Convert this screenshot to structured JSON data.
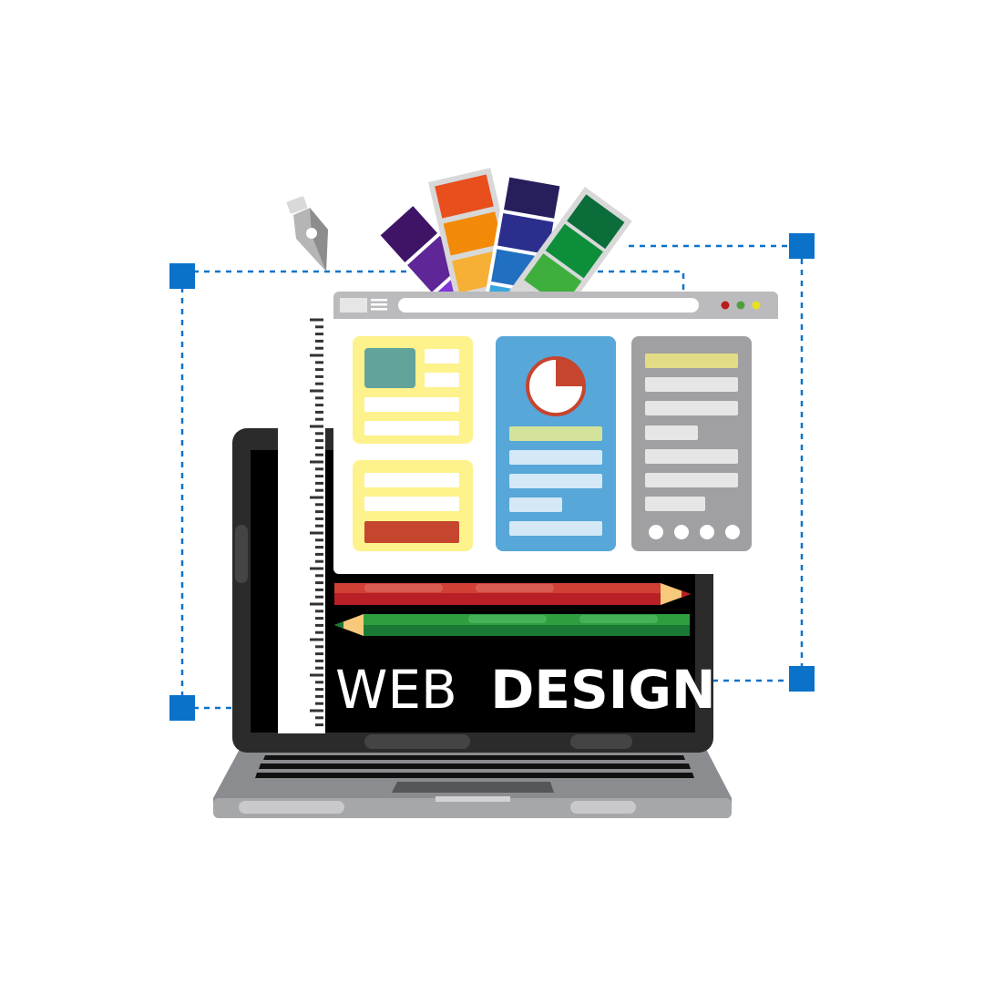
{
  "title": {
    "light": "WEB",
    "bold": "DESIGN"
  },
  "colors": {
    "selection_handle": "#0A72C9",
    "laptop_frame": "#2b2b2b",
    "laptop_base": "#8a8c8f",
    "screen": "#000000",
    "card_yellow": "#FDF28C",
    "card_blue": "#57A7D9",
    "card_gray": "#A0A0A2",
    "pencil_red": "#C63A2D",
    "pencil_green": "#2E9E3E",
    "browser_dot_red": "#B81C1C",
    "browser_dot_green": "#4E9E3E",
    "browser_dot_yellow": "#E6E21C"
  },
  "icons": [
    "pen-tool-icon",
    "color-swatch-fan-icon",
    "pie-chart-icon",
    "hamburger-menu-icon",
    "ruler-icon",
    "pencil-icon"
  ]
}
